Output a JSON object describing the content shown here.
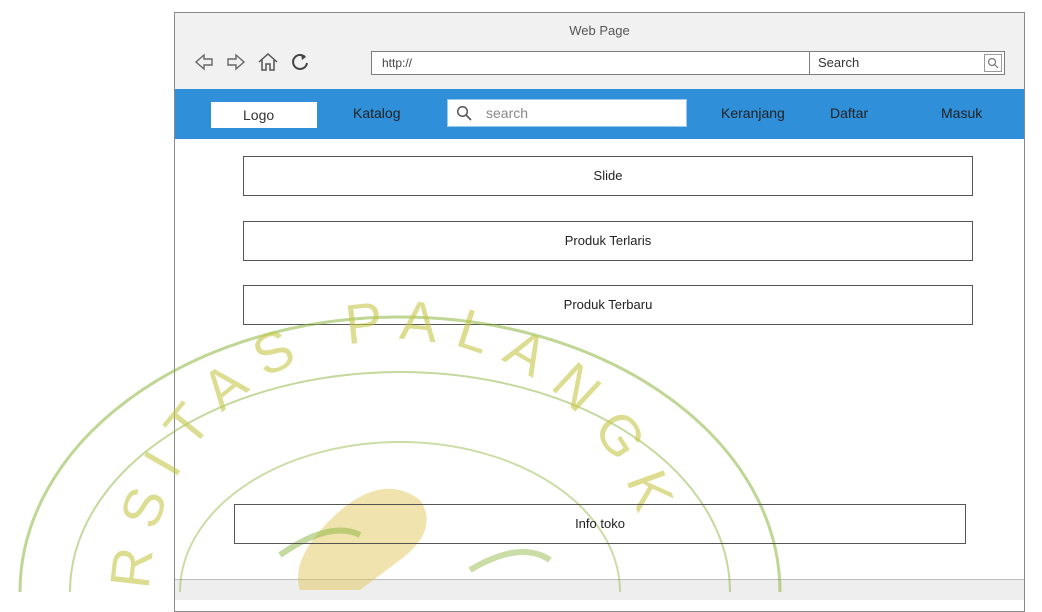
{
  "browser": {
    "title": "Web Page",
    "url": "http://",
    "search_label": "Search",
    "icons": [
      "back-arrow-icon",
      "forward-arrow-icon",
      "home-icon",
      "reload-icon",
      "search-icon"
    ]
  },
  "navbar": {
    "logo": "Logo",
    "catalog": "Katalog",
    "search_placeholder": "search",
    "cart": "Keranjang",
    "register": "Daftar",
    "login": "Masuk",
    "color": "#2f8fd8"
  },
  "main": {
    "sections": [
      "Slide",
      "Produk Terlaris",
      "Produk Terbaru"
    ],
    "footer": "Info toko"
  },
  "watermark": {
    "text": "UNIVERSITAS PALANGKA",
    "color": "#8ab43c"
  }
}
